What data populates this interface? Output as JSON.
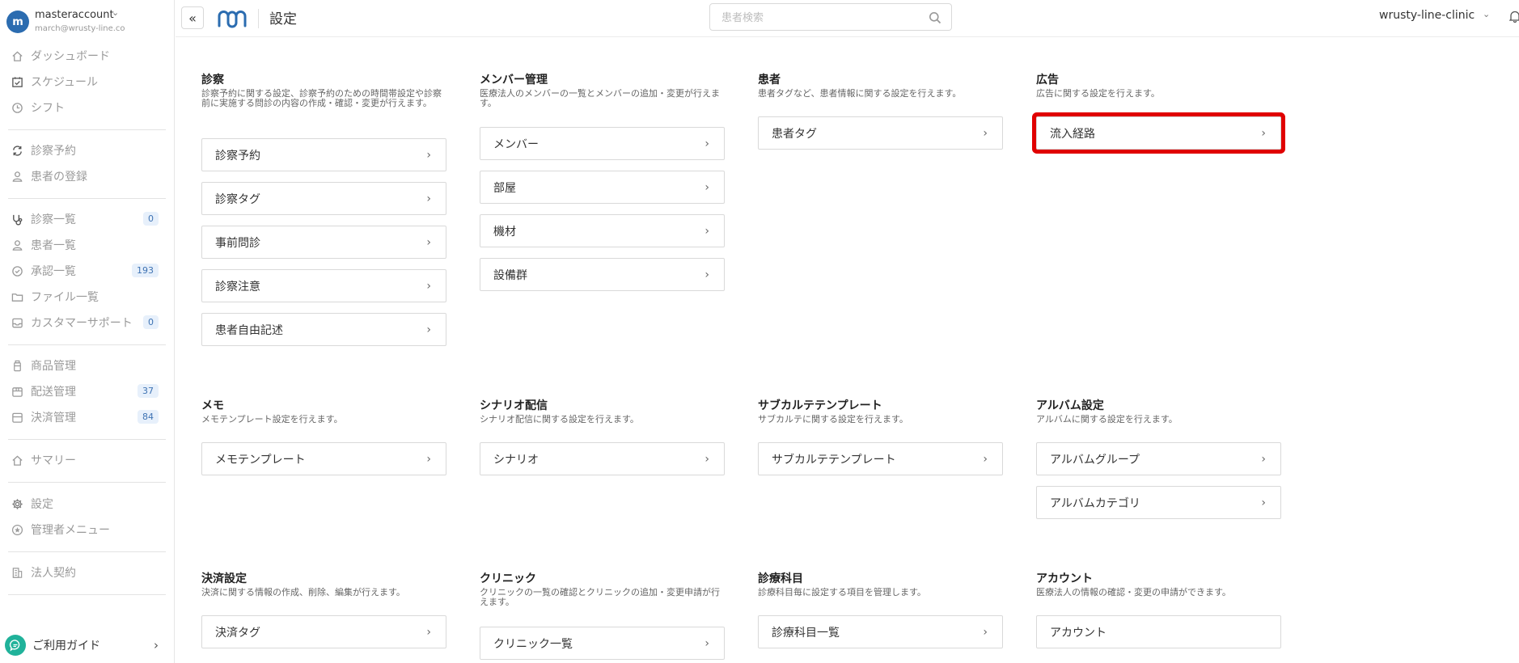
{
  "account": {
    "avatar_letter": "m",
    "name": "masteraccount",
    "email": "march@wrusty-line.co"
  },
  "sidebar": {
    "items": [
      {
        "label": "ダッシュボード",
        "icon": "home-icon",
        "badge": ""
      },
      {
        "label": "スケジュール",
        "icon": "calendar-check-icon",
        "badge": ""
      },
      {
        "label": "シフト",
        "icon": "clock-icon",
        "badge": ""
      },
      {
        "label": "診察予約",
        "icon": "sync-icon",
        "badge": ""
      },
      {
        "label": "患者の登録",
        "icon": "user-icon",
        "badge": ""
      },
      {
        "label": "診察一覧",
        "icon": "stethoscope-icon",
        "badge": "0"
      },
      {
        "label": "患者一覧",
        "icon": "user-icon",
        "badge": ""
      },
      {
        "label": "承認一覧",
        "icon": "check-circle-icon",
        "badge": "193"
      },
      {
        "label": "ファイル一覧",
        "icon": "folder-icon",
        "badge": ""
      },
      {
        "label": "カスタマーサポート",
        "icon": "inbox-icon",
        "badge": "0"
      },
      {
        "label": "商品管理",
        "icon": "bottle-icon",
        "badge": ""
      },
      {
        "label": "配送管理",
        "icon": "box-icon",
        "badge": "37"
      },
      {
        "label": "決済管理",
        "icon": "wallet-icon",
        "badge": "84"
      },
      {
        "label": "サマリー",
        "icon": "home-icon",
        "badge": ""
      },
      {
        "label": "設定",
        "icon": "gear-icon",
        "badge": ""
      },
      {
        "label": "管理者メニュー",
        "icon": "star-circle-icon",
        "badge": ""
      },
      {
        "label": "法人契約",
        "icon": "building-icon",
        "badge": ""
      }
    ],
    "guide_label": "ご利用ガイド"
  },
  "header": {
    "collapse_glyph": "«",
    "title": "設定",
    "search_placeholder": "患者検索",
    "clinic_name": "wrusty-line-clinic"
  },
  "sections": [
    {
      "title": "診察",
      "desc": "診察予約に関する設定、診察予約のための時間帯設定や診察前に実施する問診の内容の作成・確認・変更が行えます。",
      "items": [
        "診察予約",
        "診察タグ",
        "事前問診",
        "診察注意",
        "患者自由記述"
      ]
    },
    {
      "title": "メンバー管理",
      "desc": "医療法人のメンバーの一覧とメンバーの追加・変更が行えます。",
      "items": [
        "メンバー",
        "部屋",
        "機材",
        "設備群"
      ]
    },
    {
      "title": "患者",
      "desc": "患者タグなど、患者情報に関する設定を行えます。",
      "items": [
        "患者タグ"
      ]
    },
    {
      "title": "広告",
      "desc": "広告に関する設定を行えます。",
      "items": [
        "流入経路"
      ]
    },
    {
      "title": "メモ",
      "desc": "メモテンプレート設定を行えます。",
      "items": [
        "メモテンプレート"
      ]
    },
    {
      "title": "シナリオ配信",
      "desc": "シナリオ配信に関する設定を行えます。",
      "items": [
        "シナリオ"
      ]
    },
    {
      "title": "サブカルテテンプレート",
      "desc": "サブカルテに関する設定を行えます。",
      "items": [
        "サブカルテテンプレート"
      ]
    },
    {
      "title": "アルバム設定",
      "desc": "アルバムに関する設定を行えます。",
      "items": [
        "アルバムグループ",
        "アルバムカテゴリ"
      ]
    },
    {
      "title": "決済設定",
      "desc": "決済に関する情報の作成、削除、編集が行えます。",
      "items": [
        "決済タグ"
      ]
    },
    {
      "title": "クリニック",
      "desc": "クリニックの一覧の確認とクリニックの追加・変更申請が行えます。",
      "items": [
        "クリニック一覧"
      ]
    },
    {
      "title": "診療科目",
      "desc": "診療科目毎に設定する項目を管理します。",
      "items": [
        "診療科目一覧"
      ]
    },
    {
      "title": "アカウント",
      "desc": "医療法人の情報の確認・変更の申請ができます。",
      "items": [
        "アカウント"
      ]
    }
  ],
  "colors": {
    "accent": "#2b6cb0",
    "badge_bg": "#e7f0fb",
    "badge_text": "#3f73b3",
    "highlight": "#e00000",
    "guide": "#20b29a"
  }
}
